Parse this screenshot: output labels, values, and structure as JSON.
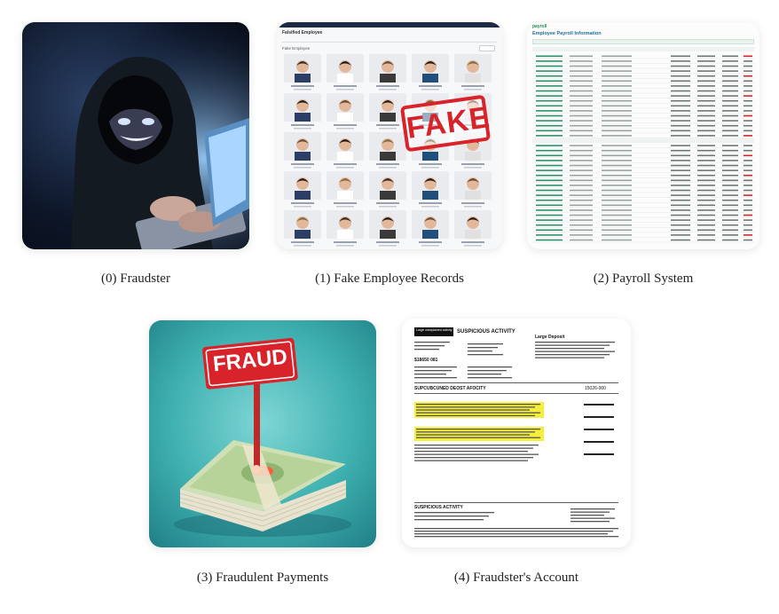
{
  "figure": {
    "panels": [
      {
        "caption": "(0) Fraudster"
      },
      {
        "caption": "(1) Fake Employee Records"
      },
      {
        "caption": "(2) Payroll System"
      },
      {
        "caption": "(3) Fraudulent Payments"
      },
      {
        "caption": "(4) Fraudster's Account"
      }
    ]
  },
  "employee_records": {
    "app_title": "Falsified Employee",
    "section_label": "Fake Employee",
    "stamp_text": "FAKE"
  },
  "payroll": {
    "brand": "payroll",
    "title": "Employee Payroll Information"
  },
  "payments": {
    "sign_text": "FRAUD"
  },
  "statement": {
    "header_left": "Large unexplained activity",
    "title": "SUSPICIOUS ACTIVITY",
    "subtitle": "Large Deposit",
    "section_a": "SUPCUBCUNED DEOST AFOCITY",
    "amount_1": "$18650 081",
    "amount_2": "15026-000",
    "footer_title": "SUSPICIOUS ACTIVITY"
  },
  "colors": {
    "fraud_red": "#d8232a",
    "teal_bg": "#3fb0b0",
    "highlight_yellow": "#f5ef3b",
    "payroll_green": "#1f8f5b"
  }
}
